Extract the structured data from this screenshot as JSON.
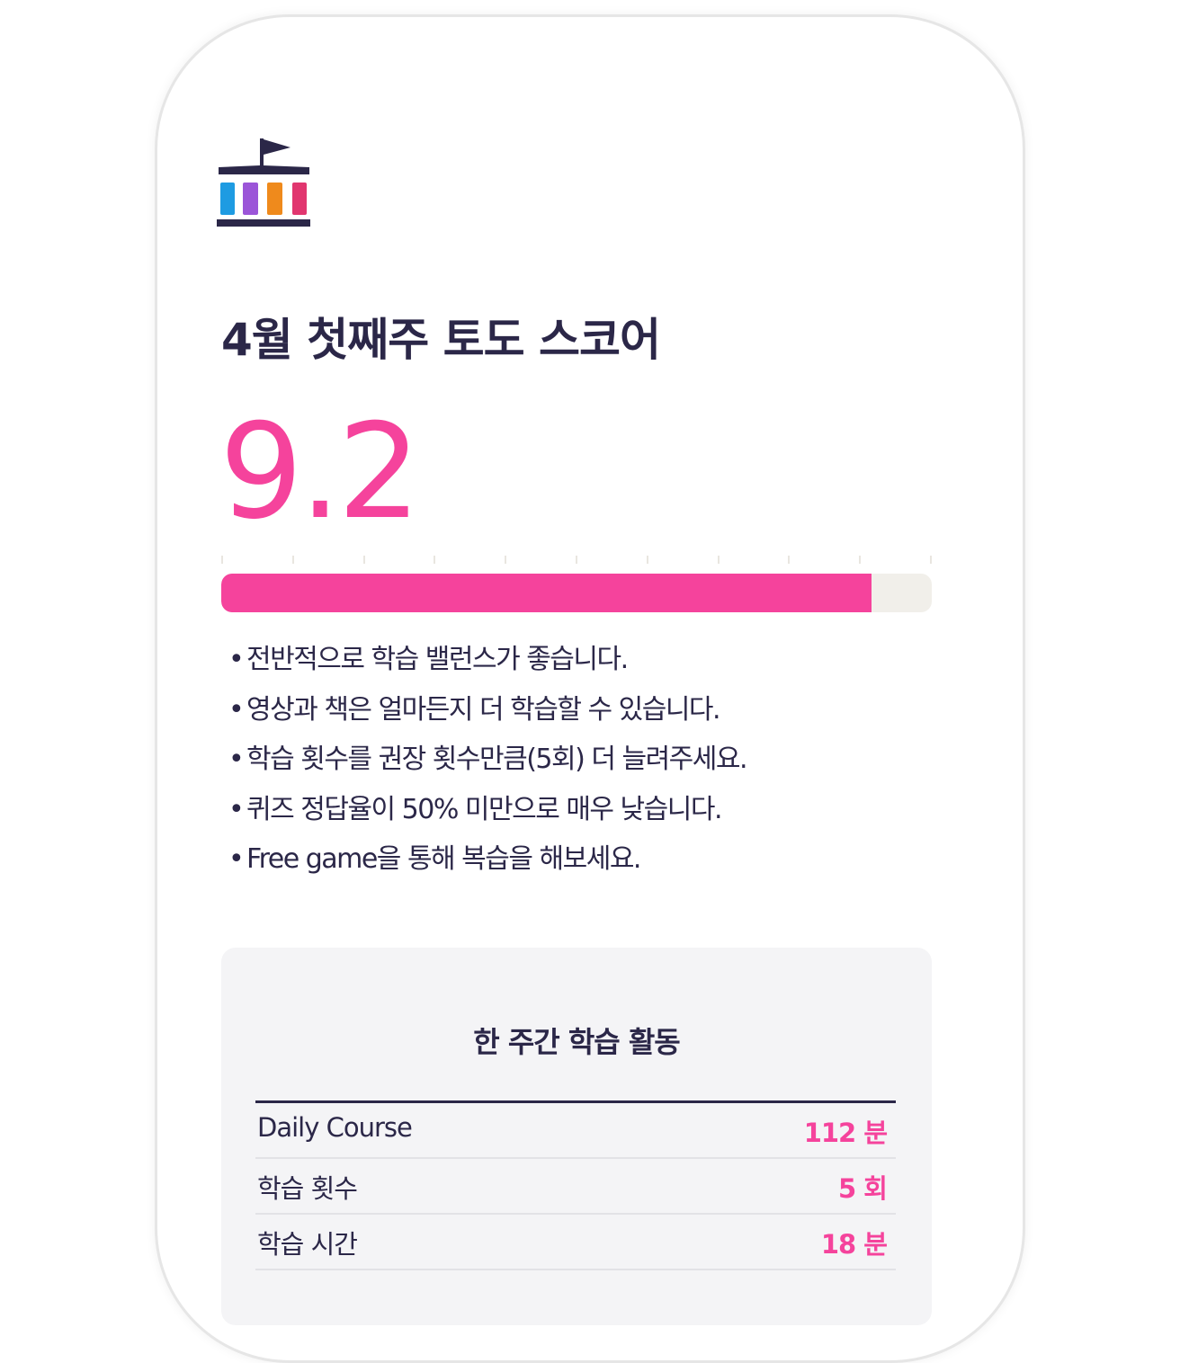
{
  "header": {
    "title": "4월 첫째주 토도 스코어"
  },
  "score": {
    "value": "9.2",
    "progress_fraction": 0.915
  },
  "feedback": [
    "전반적으로 학습 밸런스가 좋습니다.",
    "영상과 책은 얼마든지 더 학습할 수 있습니다.",
    "학습 횟수를 권장 횟수만큼(5회) 더 늘려주세요.",
    "퀴즈 정답율이 50% 미만으로 매우 낮습니다.",
    "Free game을 통해 복습을 해보세요."
  ],
  "weekly": {
    "title": "한 주간 학습 활동",
    "rows": [
      {
        "label": "Daily Course",
        "value": "112 분"
      },
      {
        "label": "학습 횟수",
        "value": "5 회"
      },
      {
        "label": "학습 시간",
        "value": "18 분"
      }
    ]
  },
  "colors": {
    "accent": "#f5439c",
    "text": "#2b2748",
    "logo_blue": "#1e9be2",
    "logo_purple": "#9b55d8",
    "logo_orange": "#ef8a1c",
    "logo_pink": "#e1366f"
  },
  "icons": {
    "logo": "school-flag-icon"
  }
}
